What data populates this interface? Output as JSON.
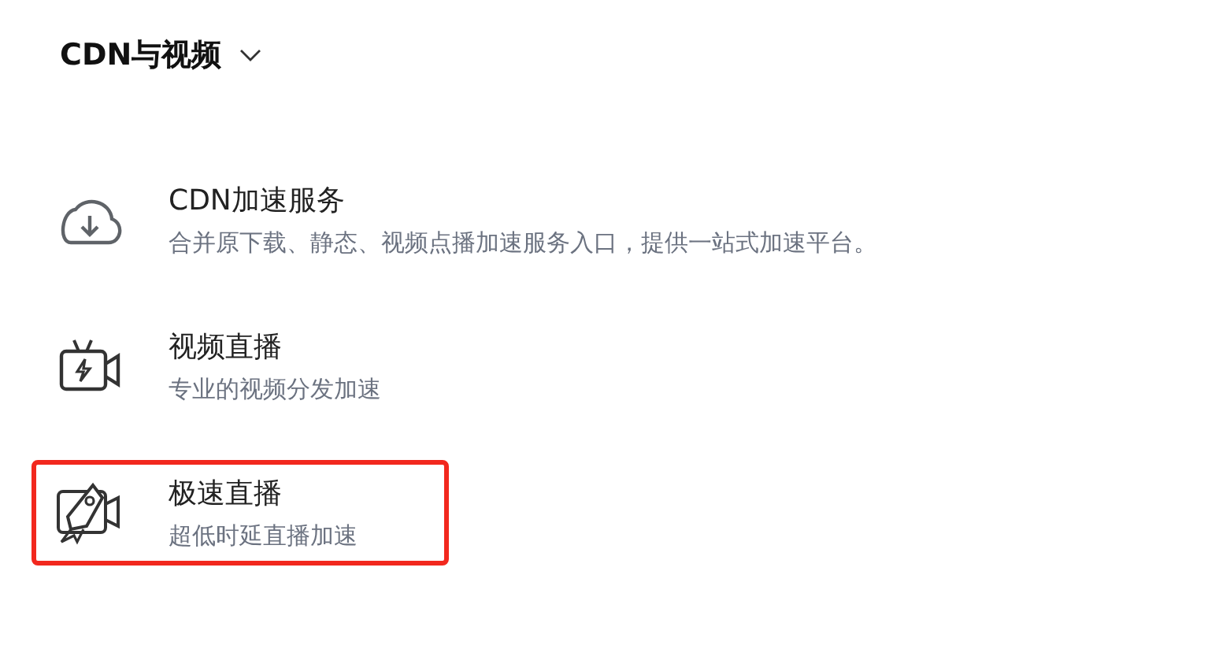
{
  "header": {
    "title": "CDN与视频",
    "expanded": true
  },
  "items": [
    {
      "kind": "cloud",
      "title": "CDN加速服务",
      "description": "合并原下载、静态、视频点播加速服务入口，提供一站式加速平台。",
      "highlighted": false
    },
    {
      "kind": "camera",
      "title": "视频直播",
      "description": "专业的视频分发加速",
      "highlighted": false
    },
    {
      "kind": "rocket",
      "title": "极速直播",
      "description": "超低时延直播加速",
      "highlighted": true
    }
  ]
}
